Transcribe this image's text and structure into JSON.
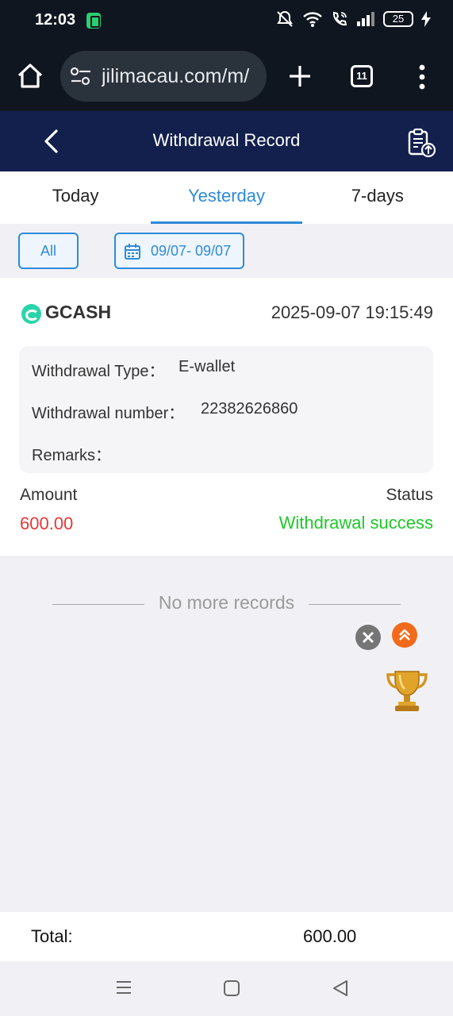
{
  "status_bar": {
    "time": "12:03",
    "battery": "25",
    "icons": [
      "app-notification-icon",
      "mute-icon",
      "wifi-icon",
      "wifi-call-icon",
      "signal-icon",
      "battery-icon",
      "charging-icon"
    ]
  },
  "browser": {
    "url": "jilimacau.com/m/",
    "tab_count": "11",
    "icons": [
      "home-icon",
      "site-settings-icon",
      "new-tab-icon",
      "tab-switcher-icon",
      "more-options-icon"
    ]
  },
  "header": {
    "title": "Withdrawal Record",
    "icons": [
      "back-arrow-icon",
      "clipboard-upload-icon"
    ]
  },
  "tabs": [
    {
      "label": "Today",
      "active": false
    },
    {
      "label": "Yesterday",
      "active": true
    },
    {
      "label": "7-days",
      "active": false
    }
  ],
  "filters": {
    "type": "All",
    "date_range": "09/07- 09/07"
  },
  "record": {
    "provider": "GCASH",
    "datetime": "2025-09-07 19:15:49",
    "withdrawal_type_label": "Withdrawal Type：",
    "withdrawal_type_value": "E-wallet",
    "withdrawal_number_label": "Withdrawal number：",
    "withdrawal_number_value": "22382626860",
    "remarks_label": "Remarks：",
    "remarks_value": "",
    "amount_label": "Amount",
    "amount_value": "600.00",
    "status_label": "Status",
    "status_value": "Withdrawal success"
  },
  "list_end_text": "No more records",
  "total": {
    "label": "Total:",
    "value": "600.00"
  },
  "colors": {
    "header_bg": "#13204d",
    "accent": "#2e8bd8",
    "amount": "#e53935",
    "success": "#1ec828"
  }
}
